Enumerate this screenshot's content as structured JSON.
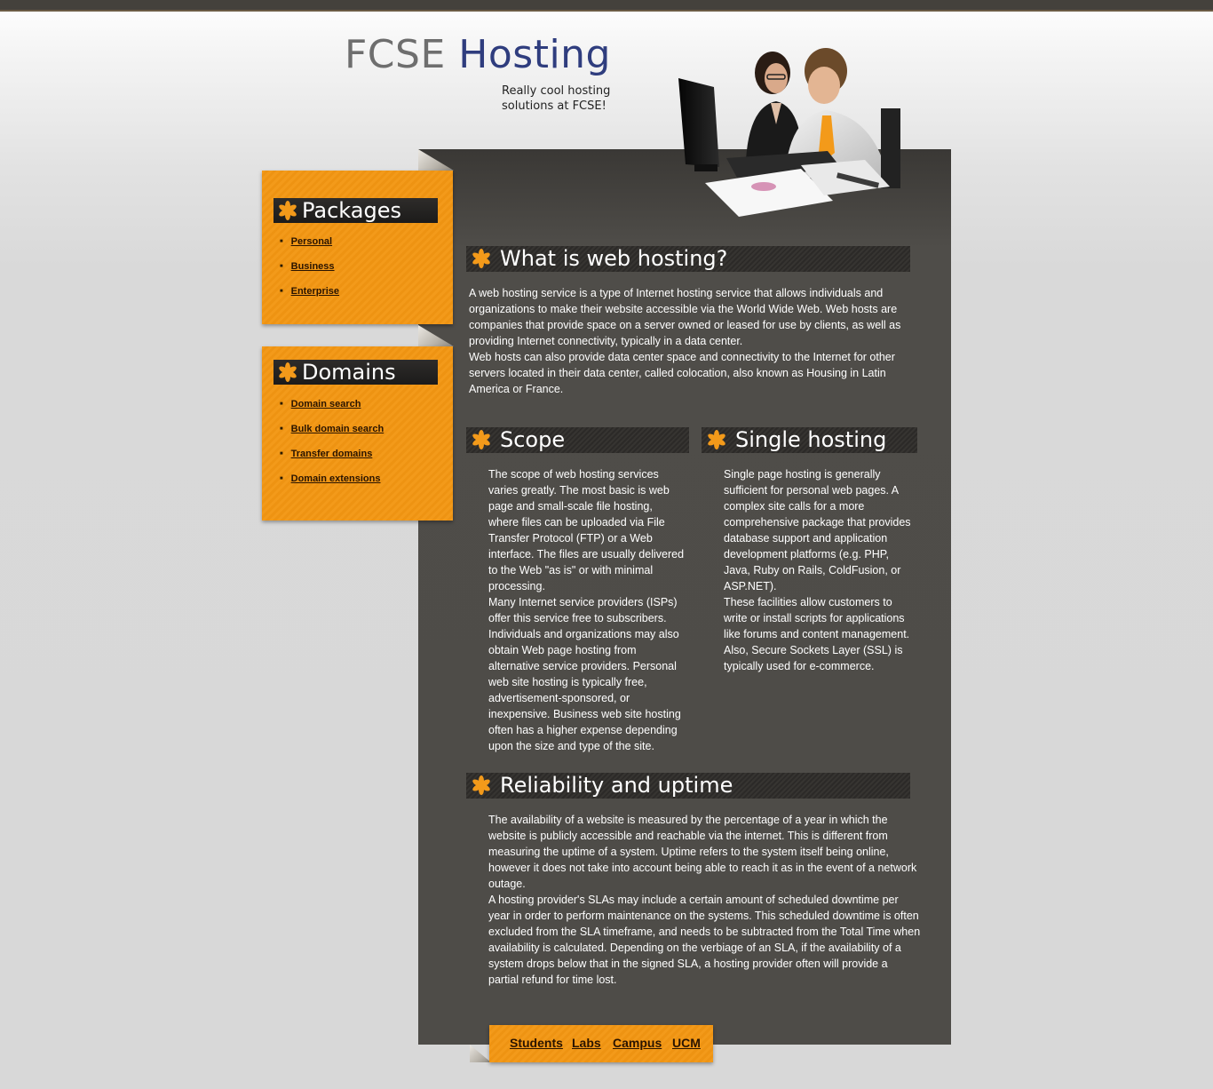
{
  "logo": {
    "part1": "FCSE",
    "part2": "Hosting",
    "tagline": "Really cool hosting solutions at FCSE!"
  },
  "sidebar": {
    "packages": {
      "title": "Packages",
      "items": [
        {
          "label": "Personal"
        },
        {
          "label": "Business"
        },
        {
          "label": "Enterprise"
        }
      ]
    },
    "domains": {
      "title": "Domains",
      "items": [
        {
          "label": "Domain search"
        },
        {
          "label": "Bulk domain search"
        },
        {
          "label": "Transfer domains"
        },
        {
          "label": "Domain extensions"
        }
      ]
    }
  },
  "sections": {
    "what": {
      "title": "What is web hosting?",
      "paragraphs": [
        "A web hosting service is a type of Internet hosting service that allows individuals and organizations to make their website accessible via the World Wide Web. Web hosts are companies that provide space on a server owned or leased for use by clients, as well as providing Internet connectivity, typically in a data center.",
        "Web hosts can also provide data center space and connectivity to the Internet for other servers located in their data center, called colocation, also known as Housing in Latin America or France."
      ]
    },
    "scope": {
      "title": "Scope",
      "paragraphs": [
        "The scope of web hosting services varies greatly. The most basic is web page and small-scale file hosting, where files can be uploaded via File Transfer Protocol (FTP) or a Web interface. The files are usually delivered to the Web \"as is\" or with minimal processing.",
        "Many Internet service providers (ISPs) offer this service free to subscribers. Individuals and organizations may also obtain Web page hosting from alternative service providers. Personal web site hosting is typically free, advertisement-sponsored, or inexpensive. Business web site hosting often has a higher expense depending upon the size and type of the site."
      ]
    },
    "single": {
      "title": "Single hosting",
      "paragraphs": [
        "Single page hosting is generally sufficient for personal web pages. A complex site calls for a more comprehensive package that provides database support and application development platforms (e.g. PHP, Java, Ruby on Rails, ColdFusion, or ASP.NET).",
        "These facilities allow customers to write or install scripts for applications like forums and content management. Also, Secure Sockets Layer (SSL) is typically used for e-commerce."
      ]
    },
    "reliability": {
      "title": "Reliability and uptime",
      "paragraphs": [
        "The availability of a website is measured by the percentage of a year in which the website is publicly accessible and reachable via the internet. This is different from measuring the uptime of a system. Uptime refers to the system itself being online, however it does not take into account being able to reach it as in the event of a network outage.",
        "A hosting provider's SLAs may include a certain amount of scheduled downtime per year in order to perform maintenance on the systems. This scheduled downtime is often excluded from the SLA timeframe, and needs to be subtracted from the Total Time when availability is calculated. Depending on the verbiage of an SLA, if the availability of a system drops below that in the signed SLA, a hosting provider often will provide a partial refund for time lost."
      ]
    }
  },
  "footer": {
    "links": [
      "Students",
      "Labs",
      "Campus",
      "UCM"
    ]
  },
  "colors": {
    "accent": "#f39a1a",
    "panel": "#4e4c48",
    "logo_blue": "#2f3d7e"
  }
}
